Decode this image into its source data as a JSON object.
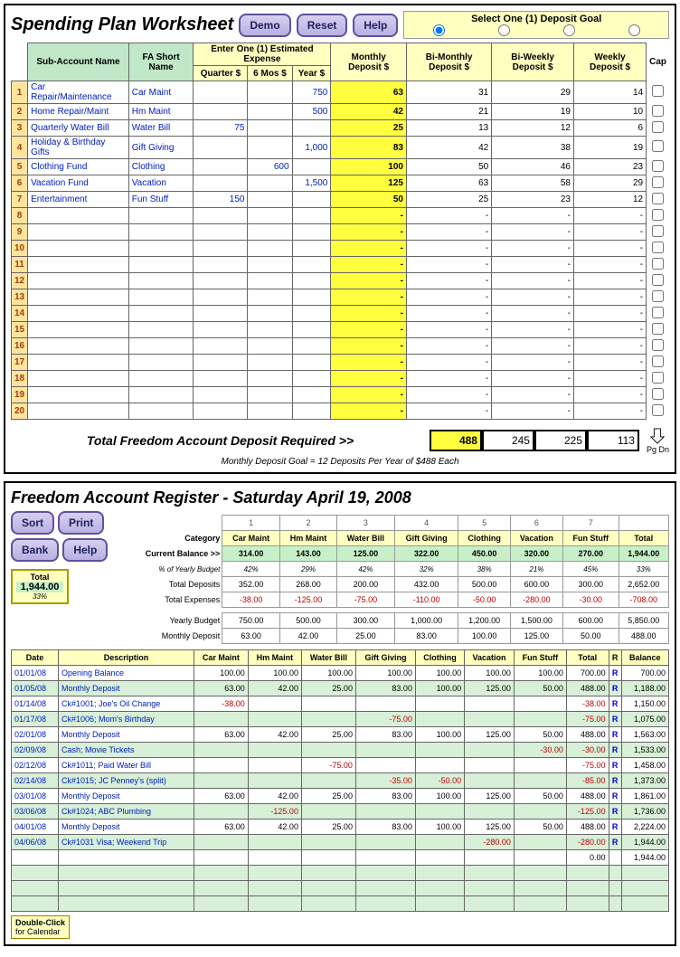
{
  "worksheet": {
    "title": "Spending Plan Worksheet",
    "buttons": {
      "demo": "Demo",
      "reset": "Reset",
      "help": "Help"
    },
    "deposit_goal_title": "Select One (1) Deposit Goal",
    "headers": {
      "sub_account": "Sub-Account Name",
      "fa_short": "FA Short Name",
      "est_expense": "Enter One (1) Estimated Expense",
      "quarter": "Quarter $",
      "six_mos": "6 Mos $",
      "year": "Year $",
      "monthly": "Monthly Deposit $",
      "bi_monthly": "Bi-Monthly Deposit $",
      "bi_weekly": "Bi-Weekly Deposit $",
      "weekly": "Weekly Deposit $",
      "cap": "Cap"
    },
    "rows": [
      {
        "n": "1",
        "name": "Car Repair/Maintenance",
        "short": "Car Maint",
        "q": "",
        "s": "",
        "y": "750",
        "m": "63",
        "bm": "31",
        "bw": "29",
        "w": "14"
      },
      {
        "n": "2",
        "name": "Home Repair/Maint",
        "short": "Hm Maint",
        "q": "",
        "s": "",
        "y": "500",
        "m": "42",
        "bm": "21",
        "bw": "19",
        "w": "10"
      },
      {
        "n": "3",
        "name": "Quarterly Water Bill",
        "short": "Water Bill",
        "q": "75",
        "s": "",
        "y": "",
        "m": "25",
        "bm": "13",
        "bw": "12",
        "w": "6"
      },
      {
        "n": "4",
        "name": "Holiday & Birthday Gifts",
        "short": "Gift Giving",
        "q": "",
        "s": "",
        "y": "1,000",
        "m": "83",
        "bm": "42",
        "bw": "38",
        "w": "19"
      },
      {
        "n": "5",
        "name": "Clothing Fund",
        "short": "Clothing",
        "q": "",
        "s": "600",
        "y": "",
        "m": "100",
        "bm": "50",
        "bw": "46",
        "w": "23"
      },
      {
        "n": "6",
        "name": "Vacation Fund",
        "short": "Vacation",
        "q": "",
        "s": "",
        "y": "1,500",
        "m": "125",
        "bm": "63",
        "bw": "58",
        "w": "29"
      },
      {
        "n": "7",
        "name": "Entertainment",
        "short": "Fun Stuff",
        "q": "150",
        "s": "",
        "y": "",
        "m": "50",
        "bm": "25",
        "bw": "23",
        "w": "12"
      },
      {
        "n": "8"
      },
      {
        "n": "9"
      },
      {
        "n": "10"
      },
      {
        "n": "11"
      },
      {
        "n": "12"
      },
      {
        "n": "13"
      },
      {
        "n": "14"
      },
      {
        "n": "15"
      },
      {
        "n": "16"
      },
      {
        "n": "17"
      },
      {
        "n": "18"
      },
      {
        "n": "19"
      },
      {
        "n": "20"
      }
    ],
    "totals_label": "Total Freedom Account Deposit Required  >>",
    "totals": {
      "m": "488",
      "bm": "245",
      "bw": "225",
      "w": "113"
    },
    "note": "Monthly Deposit Goal = 12 Deposits Per Year of $488 Each",
    "pgdn": "Pg Dn"
  },
  "register": {
    "title_prefix": "Freedom Account Register - ",
    "date": "Saturday April 19, 2008",
    "buttons": {
      "sort": "Sort",
      "print": "Print",
      "bank": "Bank",
      "help": "Help"
    },
    "total_label": "Total",
    "total_val": "1,944.00",
    "total_pct": "33%",
    "summary_labels": {
      "category": "Category",
      "current": "Current Balance >>",
      "pct": "% of Yearly Budget",
      "deposits": "Total Deposits",
      "expenses": "Total Expenses",
      "yearly": "Yearly Budget",
      "monthly": "Monthly Deposit"
    },
    "cat_nums": [
      "1",
      "2",
      "3",
      "4",
      "5",
      "6",
      "7",
      ""
    ],
    "cats": [
      "Car Maint",
      "Hm Maint",
      "Water Bill",
      "Gift Giving",
      "Clothing",
      "Vacation",
      "Fun Stuff",
      "Total"
    ],
    "current": [
      "314.00",
      "143.00",
      "125.00",
      "322.00",
      "450.00",
      "320.00",
      "270.00",
      "1,944.00"
    ],
    "pcts": [
      "42%",
      "29%",
      "42%",
      "32%",
      "38%",
      "21%",
      "45%",
      "33%"
    ],
    "deposits": [
      "352.00",
      "268.00",
      "200.00",
      "432.00",
      "500.00",
      "600.00",
      "300.00",
      "2,652.00"
    ],
    "expenses": [
      "-38.00",
      "-125.00",
      "-75.00",
      "-110.00",
      "-50.00",
      "-280.00",
      "-30.00",
      "-708.00"
    ],
    "yearly": [
      "750.00",
      "500.00",
      "300.00",
      "1,000.00",
      "1,200.00",
      "1,500.00",
      "600.00",
      "5,850.00"
    ],
    "monthlyd": [
      "63.00",
      "42.00",
      "25.00",
      "83.00",
      "100.00",
      "125.00",
      "50.00",
      "488.00"
    ],
    "reg_headers": [
      "Date",
      "Description",
      "Car Maint",
      "Hm Maint",
      "Water Bill",
      "Gift Giving",
      "Clothing",
      "Vacation",
      "Fun Stuff",
      "Total",
      "R",
      "Balance"
    ],
    "reg_rows": [
      {
        "d": "01/01/08",
        "desc": "Opening Balance",
        "v": [
          "100.00",
          "100.00",
          "100.00",
          "100.00",
          "100.00",
          "100.00",
          "100.00"
        ],
        "t": "700.00",
        "r": "R",
        "b": "700.00"
      },
      {
        "d": "01/05/08",
        "desc": "Monthly Deposit",
        "v": [
          "63.00",
          "42.00",
          "25.00",
          "83.00",
          "100.00",
          "125.00",
          "50.00"
        ],
        "t": "488.00",
        "r": "R",
        "b": "1,188.00"
      },
      {
        "d": "01/14/08",
        "desc": "Ck#1001; Joe's Oil Change",
        "v": [
          "-38.00",
          "",
          "",
          "",
          "",
          "",
          ""
        ],
        "t": "-38.00",
        "r": "R",
        "b": "1,150.00"
      },
      {
        "d": "01/17/08",
        "desc": "Ck#1006; Mom's Birthday",
        "v": [
          "",
          "",
          "",
          "-75.00",
          "",
          "",
          ""
        ],
        "t": "-75.00",
        "r": "R",
        "b": "1,075.00"
      },
      {
        "d": "02/01/08",
        "desc": "Monthly Deposit",
        "v": [
          "63.00",
          "42.00",
          "25.00",
          "83.00",
          "100.00",
          "125.00",
          "50.00"
        ],
        "t": "488.00",
        "r": "R",
        "b": "1,563.00"
      },
      {
        "d": "02/09/08",
        "desc": "Cash; Movie Tickets",
        "v": [
          "",
          "",
          "",
          "",
          "",
          "",
          "-30.00"
        ],
        "t": "-30.00",
        "r": "R",
        "b": "1,533.00"
      },
      {
        "d": "02/12/08",
        "desc": "Ck#1011; Paid Water Bill",
        "v": [
          "",
          "",
          "-75.00",
          "",
          "",
          "",
          ""
        ],
        "t": "-75.00",
        "r": "R",
        "b": "1,458.00"
      },
      {
        "d": "02/14/08",
        "desc": "Ck#1015; JC Penney's (split)",
        "v": [
          "",
          "",
          "",
          "-35.00",
          "-50.00",
          "",
          ""
        ],
        "t": "-85.00",
        "r": "R",
        "b": "1,373.00"
      },
      {
        "d": "03/01/08",
        "desc": "Monthly Deposit",
        "v": [
          "63.00",
          "42.00",
          "25.00",
          "83.00",
          "100.00",
          "125.00",
          "50.00"
        ],
        "t": "488.00",
        "r": "R",
        "b": "1,861.00"
      },
      {
        "d": "03/06/08",
        "desc": "Ck#1024; ABC Plumbing",
        "v": [
          "",
          "-125.00",
          "",
          "",
          "",
          "",
          ""
        ],
        "t": "-125.00",
        "r": "R",
        "b": "1,736.00"
      },
      {
        "d": "04/01/08",
        "desc": "Monthly Deposit",
        "v": [
          "63.00",
          "42.00",
          "25.00",
          "83.00",
          "100.00",
          "125.00",
          "50.00"
        ],
        "t": "488.00",
        "r": "R",
        "b": "2,224.00"
      },
      {
        "d": "04/06/08",
        "desc": "Ck#1031 Visa; Weekend Trip",
        "v": [
          "",
          "",
          "",
          "",
          "",
          "-280.00",
          ""
        ],
        "t": "-280.00",
        "r": "R",
        "b": "1,944.00"
      },
      {
        "d": "",
        "desc": "",
        "v": [
          "",
          "",
          "",
          "",
          "",
          "",
          ""
        ],
        "t": "0.00",
        "r": "",
        "b": "1,944.00"
      }
    ],
    "tooltip_l1": "Double-Click",
    "tooltip_l2": "for Calendar"
  }
}
